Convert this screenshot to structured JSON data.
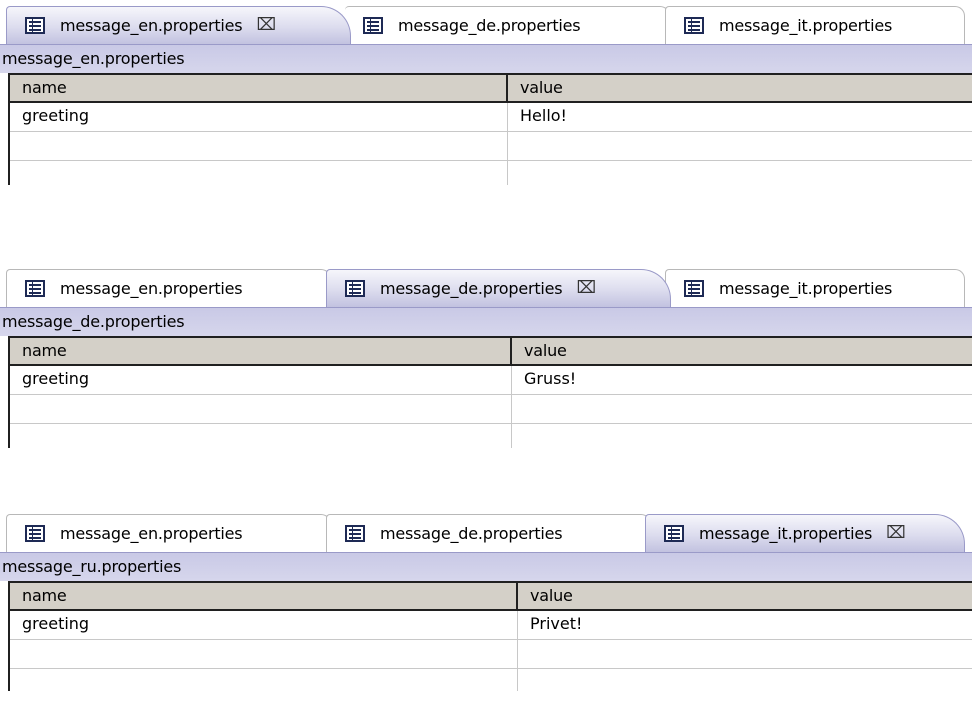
{
  "panels": [
    {
      "tabs": [
        {
          "label": "message_en.properties",
          "active": true
        },
        {
          "label": "message_de.properties",
          "active": false
        },
        {
          "label": "message_it.properties",
          "active": false
        }
      ],
      "file_label": "message_en.properties",
      "columns": {
        "name": "name",
        "value": "value"
      },
      "rows": [
        {
          "name": "greeting",
          "value": "Hello!"
        },
        {
          "name": "",
          "value": ""
        },
        {
          "name": "",
          "value": ""
        }
      ]
    },
    {
      "tabs": [
        {
          "label": "message_en.properties",
          "active": false
        },
        {
          "label": "message_de.properties",
          "active": true
        },
        {
          "label": "message_it.properties",
          "active": false
        }
      ],
      "file_label": "message_de.properties",
      "columns": {
        "name": "name",
        "value": "value"
      },
      "rows": [
        {
          "name": "greeting",
          "value": "Gruss!"
        },
        {
          "name": "",
          "value": ""
        },
        {
          "name": "",
          "value": ""
        }
      ]
    },
    {
      "tabs": [
        {
          "label": "message_en.properties",
          "active": false
        },
        {
          "label": "message_de.properties",
          "active": false
        },
        {
          "label": "message_it.properties",
          "active": true
        }
      ],
      "file_label": "message_ru.properties",
      "columns": {
        "name": "name",
        "value": "value"
      },
      "rows": [
        {
          "name": "greeting",
          "value": "Privet!"
        },
        {
          "name": "",
          "value": ""
        },
        {
          "name": "",
          "value": ""
        }
      ]
    }
  ],
  "icons": {
    "tab": "properties-file-icon",
    "close": "close-icon"
  },
  "colors": {
    "active_tab": "#c2c2e0",
    "file_bar": "#d0d0ea",
    "header": "#d4d0c8"
  }
}
